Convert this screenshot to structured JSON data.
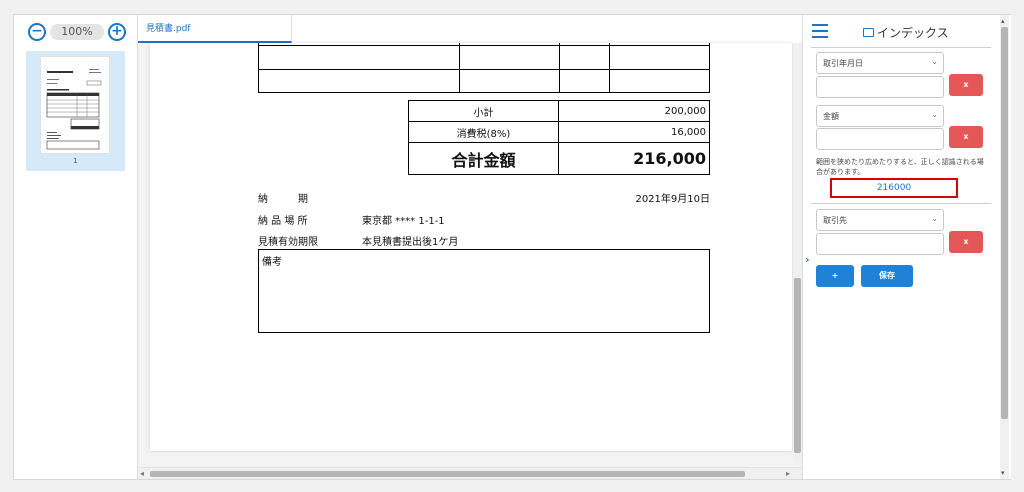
{
  "zoom": {
    "minus": "−",
    "level": "100%",
    "plus": "+"
  },
  "thumbnails": [
    {
      "page_number": "1"
    }
  ],
  "tab": {
    "filename": "見積書.pdf"
  },
  "document": {
    "summary": [
      {
        "label": "小計",
        "value": "200,000"
      },
      {
        "label": "消費税(8%)",
        "value": "16,000"
      },
      {
        "label": "合計金額",
        "value": "216,000"
      }
    ],
    "delivery": {
      "label": "納　　　期",
      "value": "2021年9月10日"
    },
    "place": {
      "label": "納 品 場 所",
      "value": "東京都 **** 1-1-1"
    },
    "validity": {
      "label": "見積有効期限",
      "value": "本見積書提出後1ケ月"
    },
    "notes_label": "備考"
  },
  "index_panel": {
    "title": "インデックス",
    "fields": [
      {
        "select": "取引年月日",
        "input": "",
        "delete": "x"
      },
      {
        "select": "金額",
        "input": "",
        "delete": "x"
      },
      {
        "select": "取引先",
        "input": "",
        "delete": "x"
      }
    ],
    "hint": "範囲を狭めたり広めたりすると、正しく認識される場合があります。",
    "detected_value": "216000",
    "add_label": "+",
    "save_label": "保存"
  },
  "colors": {
    "accent": "#1f73c7",
    "danger": "#e55757",
    "highlight": "#d60000",
    "thumb_selected": "#d6e9f8"
  }
}
